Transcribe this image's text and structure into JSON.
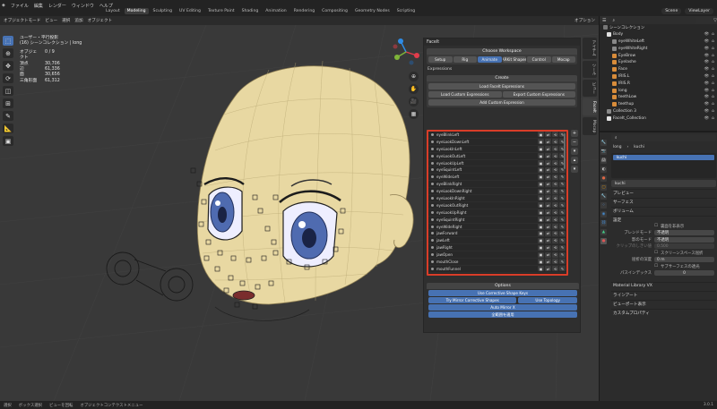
{
  "menu": [
    "ファイル",
    "編集",
    "レンダー",
    "ウィンドウ",
    "ヘルプ"
  ],
  "workspaces": [
    "Layout",
    "Modeling",
    "Sculpting",
    "UV Editing",
    "Texture Paint",
    "Shading",
    "Animation",
    "Rendering",
    "Compositing",
    "Geometry Nodes",
    "Scripting"
  ],
  "active_workspace": "Modeling",
  "scene_label": "Scene",
  "view_layer_label": "ViewLayer",
  "viewport_header": [
    "オブジェクトモード",
    "ビュー",
    "選択",
    "追加",
    "オブジェクト"
  ],
  "viewport_right_label": "オプション",
  "stats": {
    "line1": "ユーザー・平行投影",
    "line2": "(16) シーンコレクション | long",
    "obj_label": "オブジェクト",
    "obj_value": "0 / 9",
    "rows": [
      {
        "k": "頂点",
        "v": "30,706"
      },
      {
        "k": "辺",
        "v": "61,336"
      },
      {
        "k": "面",
        "v": "30,656"
      },
      {
        "k": "三角形面",
        "v": "61,312"
      }
    ]
  },
  "faceit": {
    "panel_title": "FaceIt",
    "workspace_header": "Choose Workspace",
    "workspace_tabs": [
      "Setup",
      "Rig",
      "Animate",
      "ARKit Shapes",
      "Control",
      "Mocap"
    ],
    "active_tab": "Animate",
    "expressions_label": "Expressions",
    "create_header": "Create",
    "load_facial": "Load FaceIt Expressions",
    "load_custom": "Load Custom Expressions",
    "export_custom": "Export Custom Expressions",
    "add_custom": "Add Custom Expression",
    "shapes": [
      "eyeBlinkLeft",
      "eyeLookDownLeft",
      "eyeLookInLeft",
      "eyeLookOutLeft",
      "eyeLookUpLeft",
      "eyeSquintLeft",
      "eyeWideLeft",
      "eyeBlinkRight",
      "eyeLookDownRight",
      "eyeLookInRight",
      "eyeLookOutRight",
      "eyeLookUpRight",
      "eyeSquintRight",
      "eyeWideRight",
      "jawForward",
      "jawLeft",
      "jawRight",
      "jawOpen",
      "mouthClose",
      "mouthFunnel"
    ],
    "options_header": "Options",
    "use_corrective": "Use Corrective Shape Keys",
    "try_mirror": "Try Mirror Corrective Shapes",
    "use_topology": "Use Topology",
    "auto_mirror": "Auto Mirror X",
    "japanese_button": "全範囲を適用"
  },
  "sidebar_tabs": [
    "アイテム",
    "ツール",
    "ビュー",
    "FaceIt",
    "Mocap"
  ],
  "outliner": {
    "title": "シーンコレクション",
    "rows": [
      {
        "name": "Body",
        "color": "#e2e2e2",
        "indent": 8
      },
      {
        "name": "eyeWhiteLeft",
        "color": "#888",
        "indent": 14
      },
      {
        "name": "eyeWhiteRight",
        "color": "#888",
        "indent": 14
      },
      {
        "name": "EyeBrow",
        "color": "#d88c3a",
        "indent": 14
      },
      {
        "name": "Eyelashe",
        "color": "#d88c3a",
        "indent": 14
      },
      {
        "name": "Face",
        "color": "#d88c3a",
        "indent": 14
      },
      {
        "name": "IRIS.L",
        "color": "#d88c3a",
        "indent": 14
      },
      {
        "name": "IRIS.R",
        "color": "#d88c3a",
        "indent": 14
      },
      {
        "name": "long",
        "color": "#d88c3a",
        "indent": 14
      },
      {
        "name": "teethLow",
        "color": "#d88c3a",
        "indent": 14
      },
      {
        "name": "teethup",
        "color": "#d88c3a",
        "indent": 14
      },
      {
        "name": "Collection 3",
        "color": "#888",
        "indent": 8
      },
      {
        "name": "FaceIt_Collection",
        "color": "#e2e2e2",
        "indent": 8
      }
    ]
  },
  "properties": {
    "object_name": "long",
    "material_slot": "kuchi",
    "material_in_list": "kuchi",
    "material_field": "kuchi",
    "sections": [
      "プレビュー",
      "サーフェス",
      "ボリューム",
      "設定"
    ],
    "backface": "裏面を非表示",
    "blend_mode_label": "ブレンドモード",
    "blend_mode_value": "不透明",
    "shadow_mode_label": "影のモード",
    "shadow_mode_value": "不透明",
    "clip_label": "クリップのしきい値",
    "clip_value": "0.500",
    "screen_refraction": "スクリーンスペース屈折",
    "refraction_depth_label": "屈折の深度",
    "refraction_depth_value": "0 m",
    "subsurface": "サブサーフェスの透光",
    "pass_index_label": "パスインデックス",
    "pass_index_value": "0",
    "bottom_sections": [
      "Material Library VX",
      "ラインアート",
      "ビューポート表示",
      "カスタムプロパティ"
    ]
  },
  "status": [
    "選択",
    "ボックス選択",
    "ビューを回転",
    "オブジェクトコンテクストメニュー"
  ],
  "version": "3.0.1",
  "colors": {
    "accent": "#4772b3",
    "highlight": "#d93d28",
    "skin": "#e8d8a2"
  }
}
